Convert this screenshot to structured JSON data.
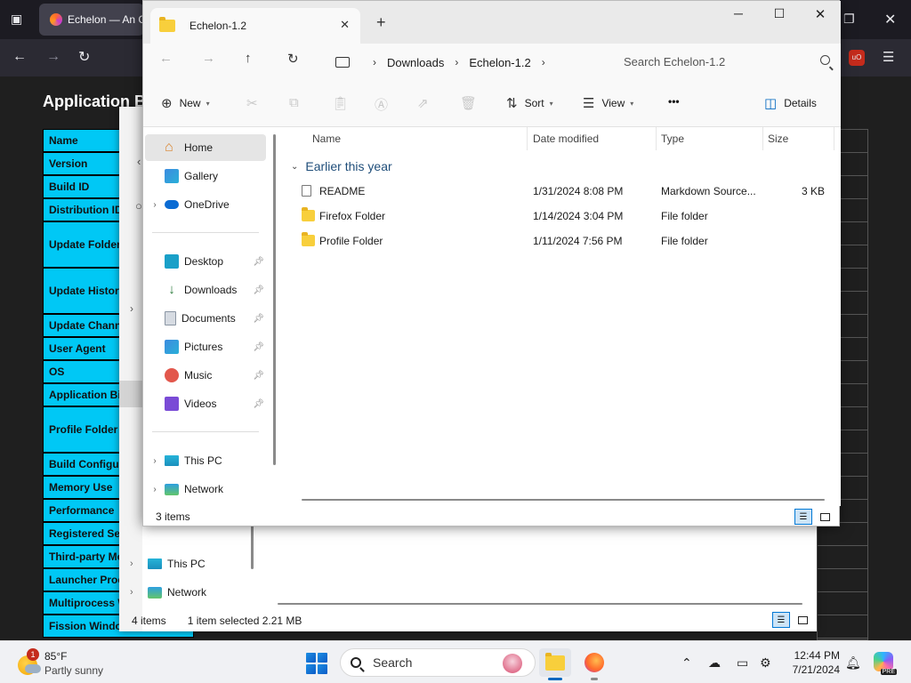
{
  "firefox": {
    "tab_title": "Echelon — An C",
    "page_heading": "Application B",
    "rows": [
      {
        "label": "Name"
      },
      {
        "label": "Version"
      },
      {
        "label": "Build ID"
      },
      {
        "label": "Distribution ID"
      },
      {
        "label": "Update Folder"
      },
      {
        "label": "Update History"
      },
      {
        "label": "Update Channe"
      },
      {
        "label": "User Agent"
      },
      {
        "label": "OS"
      },
      {
        "label": "Application Bin"
      },
      {
        "label": "Profile Folder"
      },
      {
        "label": "Build Configur"
      },
      {
        "label": "Memory Use"
      },
      {
        "label": "Performance"
      },
      {
        "label": "Registered Se"
      },
      {
        "label": "Third-party Mo"
      },
      {
        "label": "Launcher Proc"
      },
      {
        "label": "Multiprocess W"
      },
      {
        "label": "Fission Window"
      }
    ]
  },
  "explorer_back": {
    "nav": [
      {
        "label": "This PC",
        "icon": "this-pc-icon"
      },
      {
        "label": "Network",
        "icon": "network-icon"
      }
    ],
    "status_items": "4 items",
    "status_selected": "1 item selected  2.21 MB"
  },
  "explorer": {
    "tab_title": "Echelon-1.2",
    "breadcrumb": [
      "Downloads",
      "Echelon-1.2"
    ],
    "search_placeholder": "Search Echelon-1.2",
    "commands": {
      "new": "New",
      "sort": "Sort",
      "view": "View",
      "more": "•••",
      "details": "Details"
    },
    "sidebar": [
      {
        "label": "Home",
        "icon": "home-icon",
        "selected": true
      },
      {
        "label": "Gallery",
        "icon": "gallery-icon"
      },
      {
        "label": "OneDrive",
        "icon": "onedrive-icon",
        "expandable": true
      },
      {
        "label": "Desktop",
        "icon": "desktop-icon",
        "pinned": true
      },
      {
        "label": "Downloads",
        "icon": "downloads-icon",
        "pinned": true
      },
      {
        "label": "Documents",
        "icon": "documents-icon",
        "pinned": true
      },
      {
        "label": "Pictures",
        "icon": "pictures-icon",
        "pinned": true
      },
      {
        "label": "Music",
        "icon": "music-icon",
        "pinned": true
      },
      {
        "label": "Videos",
        "icon": "videos-icon",
        "pinned": true
      },
      {
        "label": "This PC",
        "icon": "this-pc-icon",
        "expandable": true
      },
      {
        "label": "Network",
        "icon": "network-icon",
        "expandable": true
      }
    ],
    "columns": {
      "name": "Name",
      "date": "Date modified",
      "type": "Type",
      "size": "Size"
    },
    "group_header": "Earlier this year",
    "files": [
      {
        "name": "README",
        "date": "1/31/2024 8:08 PM",
        "type": "Markdown Source...",
        "size": "3 KB",
        "icon": "markdown-file-icon"
      },
      {
        "name": "Firefox Folder",
        "date": "1/14/2024 3:04 PM",
        "type": "File folder",
        "size": "",
        "icon": "folder-icon"
      },
      {
        "name": "Profile Folder",
        "date": "1/11/2024 7:56 PM",
        "type": "File folder",
        "size": "",
        "icon": "folder-icon"
      }
    ],
    "status": "3 items"
  },
  "taskbar": {
    "weather_temp": "85°F",
    "weather_cond": "Partly sunny",
    "weather_badge": "1",
    "search_label": "Search",
    "time": "12:44 PM",
    "date": "7/21/2024",
    "copilot_badge": "PRE"
  }
}
